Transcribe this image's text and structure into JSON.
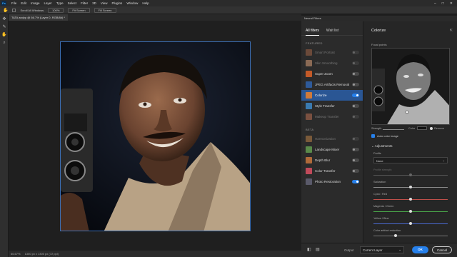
{
  "menubar": {
    "logo": "Ps",
    "items": [
      "File",
      "Edit",
      "Image",
      "Layer",
      "Type",
      "Select",
      "Filter",
      "3D",
      "View",
      "Plugins",
      "Window",
      "Help"
    ],
    "window_controls": [
      "–",
      "□",
      "✕"
    ]
  },
  "options_bar": {
    "scroll_all_windows": "Scroll All Windows",
    "zoom_value": "100%",
    "fit_screen": "Fit Screen",
    "fill_screen": "Fill Screen"
  },
  "document": {
    "tab_title": "TATA andyp @ 66.7% (Layer 0, RGB/8#) *",
    "status_zoom": "66.67%",
    "status_info": "1300 px x 1300 px (72 ppi)"
  },
  "neural_filters": {
    "panel_title": "Neural Filters",
    "tabs": {
      "all": "All filters",
      "wait": "Wait list"
    },
    "featured_title": "FEATURED",
    "beta_title": "BETA",
    "featured": [
      {
        "label": "Smart Portrait",
        "state": "dim",
        "thumb": "#6b4a3a"
      },
      {
        "label": "Skin Smoothing",
        "state": "dim",
        "thumb": "#8a6a55"
      },
      {
        "label": "Super Zoom",
        "state": "off",
        "thumb": "#c45a28"
      },
      {
        "label": "JPEG Artifacts Removal",
        "state": "off",
        "thumb": "#2e5a9a"
      },
      {
        "label": "Colorize",
        "state": "on",
        "thumb": "#d07a3a",
        "selected": true
      },
      {
        "label": "Style Transfer",
        "state": "off",
        "thumb": "#3a7ab0"
      },
      {
        "label": "Makeup Transfer",
        "state": "dim",
        "thumb": "#7a5040"
      }
    ],
    "beta": [
      {
        "label": "Harmonization",
        "state": "dim",
        "thumb": "#7a5a3a"
      },
      {
        "label": "Landscape Mixer",
        "state": "off",
        "thumb": "#5a8a4a"
      },
      {
        "label": "Depth Blur",
        "state": "off",
        "thumb": "#b06a3a"
      },
      {
        "label": "Color Transfer",
        "state": "off",
        "thumb": "#c04a5a"
      },
      {
        "label": "Photo Restoration",
        "state": "on",
        "thumb": "#5a5a6a"
      }
    ]
  },
  "colorize": {
    "title": "Colorize",
    "focal_points_label": "Focal points",
    "strength_label": "Strength",
    "color_label": "Color",
    "remove_label": "Remove",
    "auto_color_label": "Auto color image",
    "adjustments_label": "Adjustments",
    "profile_label": "Profile",
    "profile_value": "None",
    "sliders": [
      {
        "label": "Profile strength",
        "value": 0.5,
        "track": "#555555",
        "dim": true
      },
      {
        "label": "Saturation",
        "value": 0.5,
        "track": "#8a8a8a"
      },
      {
        "label": "Cyan / Red",
        "value": 0.5,
        "track": "#c0504a"
      },
      {
        "label": "Magenta / Green",
        "value": 0.5,
        "track": "#4aa84a"
      },
      {
        "label": "Yellow / Blue",
        "value": 0.5,
        "track": "#4a6ad0"
      },
      {
        "label": "Color artifact reduction",
        "value": 0.3,
        "track": "#777777"
      }
    ]
  },
  "footer": {
    "output_label": "Output",
    "output_value": "Current Layer",
    "ok": "OK",
    "cancel": "Cancel"
  },
  "colors": {
    "accent": "#2680eb",
    "selected_row": "#2a5694"
  }
}
